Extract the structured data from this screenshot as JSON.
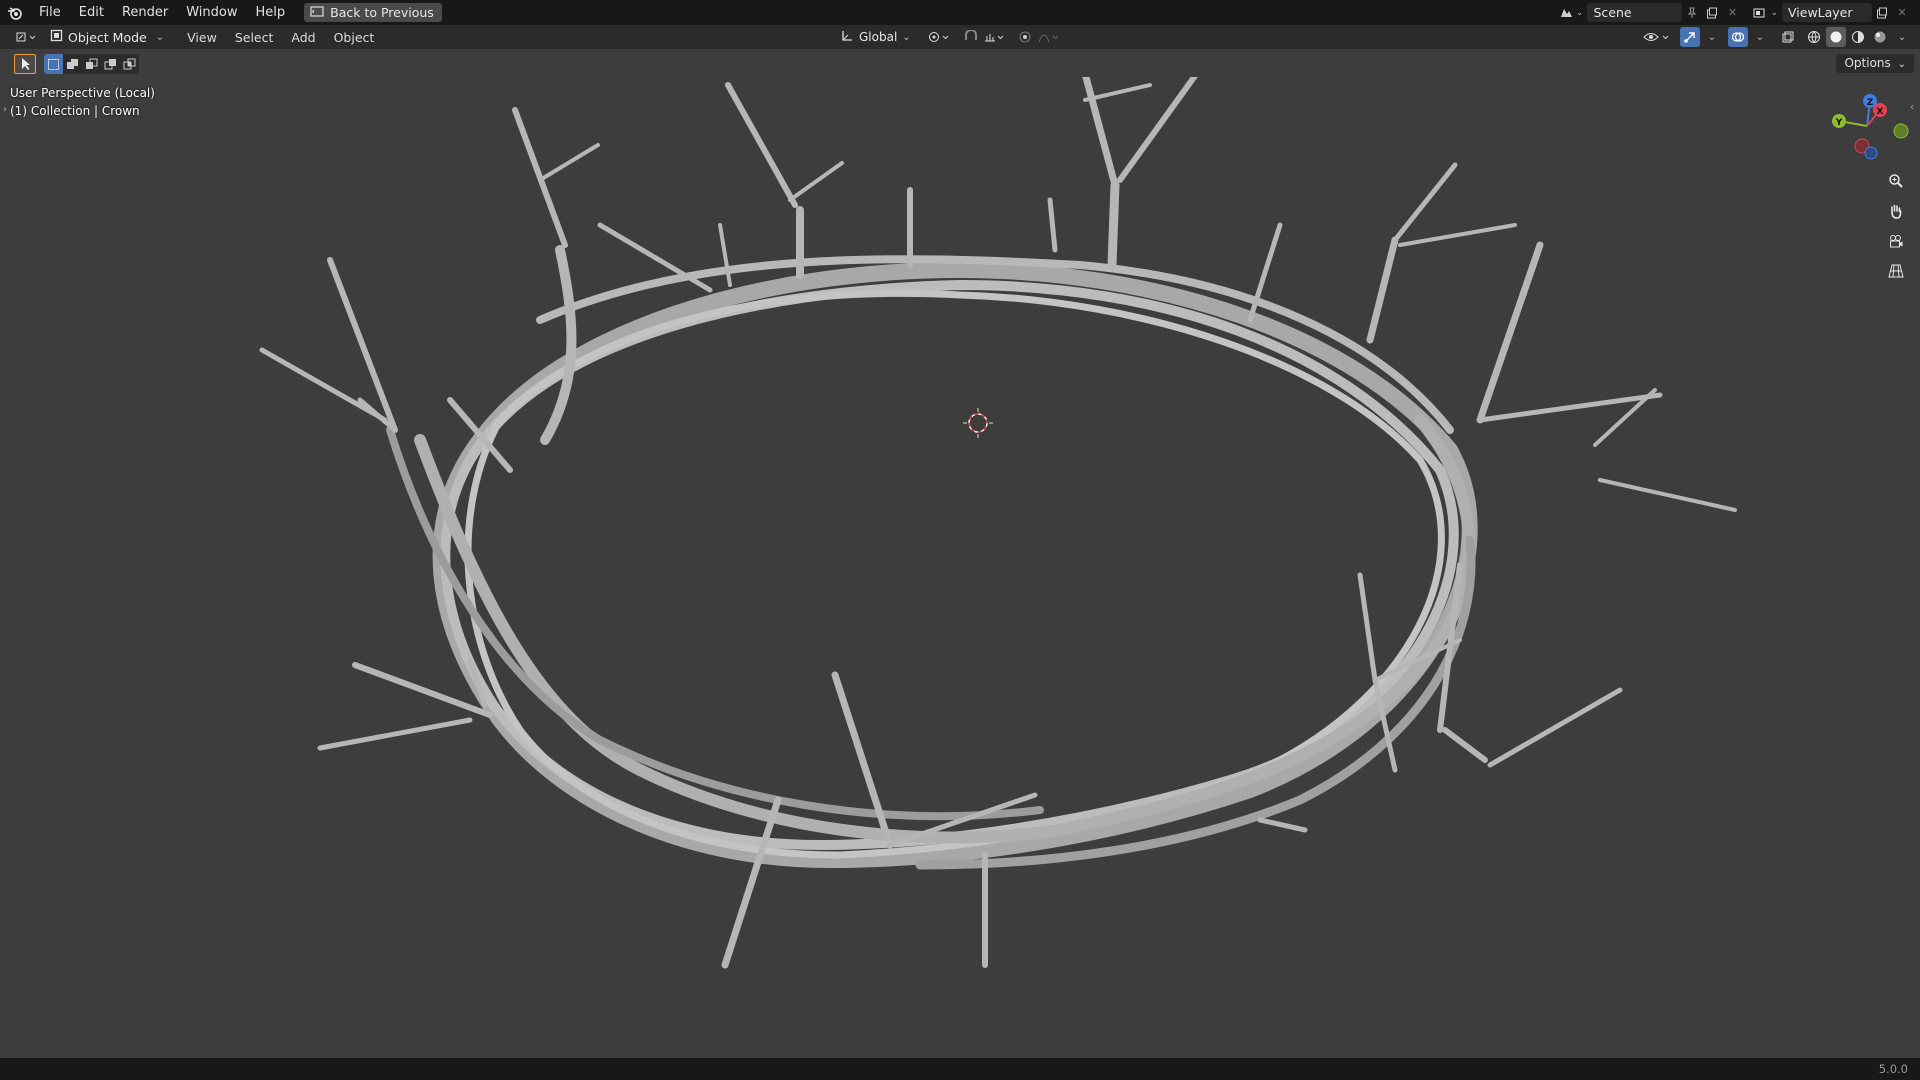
{
  "topbar": {
    "menus": [
      "File",
      "Edit",
      "Render",
      "Window",
      "Help"
    ],
    "back_button": "Back to Previous",
    "scene_name": "Scene",
    "view_layer": "ViewLayer"
  },
  "header": {
    "mode": "Object Mode",
    "menus": [
      "View",
      "Select",
      "Add",
      "Object"
    ],
    "transform_orientation": "Global"
  },
  "toolrow": {
    "options_label": "Options"
  },
  "viewport": {
    "perspective_label": "User Perspective (Local)",
    "collection_label": "(1) Collection | Crown",
    "gizmo_axes": {
      "x": "X",
      "y": "Y",
      "z": "Z"
    }
  },
  "statusbar": {
    "version": "5.0.0"
  },
  "colors": {
    "accent": "#4772b3",
    "axis_x": "#e0434f",
    "axis_y": "#8bbd2f",
    "axis_z": "#3b7ee6",
    "mesh": "#b4b4b4",
    "viewport_bg": "#3d3d3d"
  }
}
